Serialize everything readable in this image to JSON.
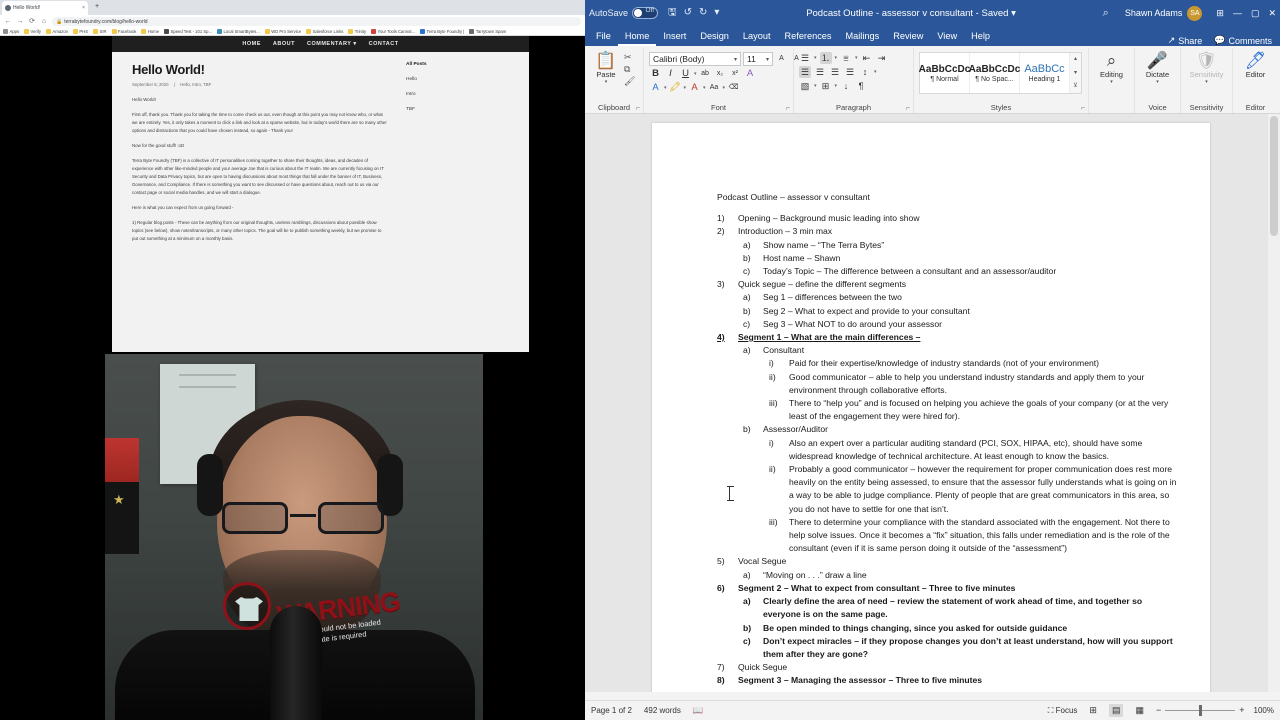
{
  "browser": {
    "tab": {
      "title": "Hello World!",
      "close_label": "×"
    },
    "new_tab_label": "+",
    "nav": {
      "back": "←",
      "forward": "→",
      "reload": "⟳",
      "home": "⌂"
    },
    "omnibox": {
      "lock": "🔒",
      "url": "terrabytefoundry.com/blog/hello-world"
    },
    "bookmarks": [
      {
        "label": "Apps",
        "color": "#8e8e8e"
      },
      {
        "label": "Verify",
        "color": "#f2c94c"
      },
      {
        "label": "Amazon",
        "color": "#f2c94c"
      },
      {
        "label": "PHS",
        "color": "#f2c94c"
      },
      {
        "label": "SIR",
        "color": "#f2c94c"
      },
      {
        "label": "Facebook",
        "color": "#f2c94c"
      },
      {
        "label": "Home",
        "color": "#f2c94c"
      },
      {
        "label": "Speed Test - 101 Sp...",
        "color": "#4a4a4a"
      },
      {
        "label": "Local SmartBytes...",
        "color": "#3c8dbc"
      },
      {
        "label": "WD Pro Service",
        "color": "#f2c94c"
      },
      {
        "label": "Salesforce Links",
        "color": "#f2c94c"
      },
      {
        "label": "Trinity",
        "color": "#f2c94c"
      },
      {
        "label": "Your Tools Cannot...",
        "color": "#d0433a"
      },
      {
        "label": "Terra Byte Foundry |",
        "color": "#2a6fd6"
      },
      {
        "label": "Tarrytown Spam",
        "color": "#6c6c6c"
      }
    ]
  },
  "site": {
    "nav": [
      "HOME",
      "ABOUT",
      "COMMENTARY ▾",
      "CONTACT"
    ],
    "post": {
      "title": "Hello World!",
      "date": "September 8, 2020",
      "tags": "Hello, Intro, TBF",
      "paragraphs": [
        "Hello World!",
        "First off, thank you.  Thank you for taking the time to come check us out, even though at this point you may not know who, or what we are entirely.  Yes, it only takes a moment to click a link and look at a sparse website, but in today's world there are so many other options and distractions that you could have chosen instead, so again - Thank you!",
        "Now for the good stuff! :oD",
        "Terra Byte Foundry (TBF) is a collective of IT personalities coming together to share their thoughts, ideas, and decades of experience with other like-minded people and your average Joe that is curious about the IT realm.  We are currently focusing on IT Security and Data Privacy topics, but are open to having discussions about most things that fall under the banner of IT, Business, Governance, and Compliance.  If there is something you want to see discussed or have questions about, reach out to us via our contact page or social media handles, and we will start a dialogue.",
        "Here is what you can expect from us going forward -",
        "1) Regular blog posts - These can be anything from our original thoughts, useless ramblings, discussions about possible show topics (see below), show notes/transcripts, or many other topics.  The goal will be to publish something weekly, but we promise to put out something at a minimum on a monthly basis."
      ]
    },
    "sidebar": {
      "heading": "All Posts",
      "links": [
        "Hello",
        "Intro",
        "TBF"
      ]
    }
  },
  "webcam": {
    "warning_text": "WARNING",
    "warning_sub1": "graphic could not be loaded",
    "warning_sub2": "software update is required"
  },
  "word": {
    "titlebar": {
      "autosave_label": "AutoSave",
      "autosave_state": "Off",
      "quick_access": [
        {
          "name": "save-icon",
          "glyph": "🖫"
        },
        {
          "name": "undo-icon",
          "glyph": "↺"
        },
        {
          "name": "redo-icon",
          "glyph": "↻"
        },
        {
          "name": "customize-qat-icon",
          "glyph": "▾"
        }
      ],
      "document_title": "Podcast Outline - assessor v consultant  -  Saved ▾",
      "search_icon": "⌕",
      "user_name": "Shawn Adams",
      "user_initials": "SA",
      "ribbon_display_icon": "⊞",
      "minimize": "—",
      "maximize": "▢",
      "close": "✕"
    },
    "tabs": [
      {
        "label": "File",
        "active": false
      },
      {
        "label": "Home",
        "active": true
      },
      {
        "label": "Insert",
        "active": false
      },
      {
        "label": "Design",
        "active": false
      },
      {
        "label": "Layout",
        "active": false
      },
      {
        "label": "References",
        "active": false
      },
      {
        "label": "Mailings",
        "active": false
      },
      {
        "label": "Review",
        "active": false
      },
      {
        "label": "View",
        "active": false
      },
      {
        "label": "Help",
        "active": false
      }
    ],
    "tabs_right": [
      {
        "label": "Share",
        "icon": "↗"
      },
      {
        "label": "Comments",
        "icon": "💬"
      }
    ],
    "ribbon": {
      "clipboard": {
        "group_label": "Clipboard",
        "paste_label": "Paste",
        "paste_icon": "📋",
        "paste_caret": "▾",
        "cut_icon": "✂",
        "copy_icon": "⧉",
        "format_painter_icon": "🖌",
        "dialog_launcher": "⌐"
      },
      "font": {
        "group_label": "Font",
        "font_name": "Calibri (Body)",
        "font_size": "11",
        "bold": "B",
        "italic": "I",
        "underline": "U",
        "strikethrough": "ab",
        "subscript": "x₂",
        "superscript": "x²",
        "text_effects_icon": "A",
        "text_highlight_icon": "🖍",
        "font_color_icon": "A",
        "change_case_icon": "Aa",
        "grow_font": "A",
        "shrink_font": "A",
        "clear_formatting": "⌫",
        "dialog_launcher": "⌐"
      },
      "paragraph": {
        "group_label": "Paragraph",
        "bullets_icon": "☰",
        "numbering_icon": "⒈",
        "multilevel_icon": "⩸",
        "decrease_indent": "⇤",
        "increase_indent": "⇥",
        "align_left": "☰",
        "align_center": "☰",
        "align_right": "☰",
        "justify": "☰",
        "line_spacing": "↕",
        "shading_icon": "▧",
        "borders_icon": "⊞",
        "sort_icon": "↓",
        "show_marks_icon": "¶",
        "dialog_launcher": "⌐"
      },
      "styles": {
        "group_label": "Styles",
        "items": [
          {
            "preview": "AaBbCcDc",
            "name": "¶ Normal"
          },
          {
            "preview": "AaBbCcDc",
            "name": "¶ No Spac..."
          },
          {
            "preview": "AaBbCc",
            "name": "Heading 1"
          }
        ],
        "scroll_up": "▴",
        "scroll_down": "▾",
        "more": "⊻",
        "dialog_launcher": "⌐"
      },
      "editing": {
        "group_label": "",
        "label": "Editing",
        "icon": "⌕",
        "caret": "▾"
      },
      "voice": {
        "group_label": "Voice",
        "label": "Dictate",
        "icon": "🎤",
        "caret": "▾"
      },
      "sensitivity": {
        "group_label": "Sensitivity",
        "label": "Sensitivity",
        "icon": "🛡",
        "caret": "▾"
      },
      "editor": {
        "group_label": "Editor",
        "label": "Editor",
        "icon": "🖊"
      }
    },
    "document": {
      "title": "Podcast Outline – assessor v consultant",
      "items": [
        {
          "level": 1,
          "marker": "1)",
          "text": "Opening – Background music leading into show",
          "bold": false,
          "underline": false
        },
        {
          "level": 1,
          "marker": "2)",
          "text": "Introduction – 3 min max",
          "bold": false,
          "underline": false
        },
        {
          "level": 2,
          "marker": "a)",
          "text": "Show name – “The Terra Bytes”",
          "bold": false,
          "underline": false
        },
        {
          "level": 2,
          "marker": "b)",
          "text": "Host name – Shawn",
          "bold": false,
          "underline": false
        },
        {
          "level": 2,
          "marker": "c)",
          "text": "Today’s Topic – The difference between a consultant and an assessor/auditor",
          "bold": false,
          "underline": false
        },
        {
          "level": 1,
          "marker": "3)",
          "text": "Quick segue – define the different segments",
          "bold": false,
          "underline": false
        },
        {
          "level": 2,
          "marker": "a)",
          "text": "Seg 1 – differences between the two",
          "bold": false,
          "underline": false
        },
        {
          "level": 2,
          "marker": "b)",
          "text": "Seg 2 – What to expect and provide to your consultant",
          "bold": false,
          "underline": false
        },
        {
          "level": 2,
          "marker": "c)",
          "text": "Seg 3 – What NOT to do around your assessor",
          "bold": false,
          "underline": false
        },
        {
          "level": 1,
          "marker": "4)",
          "text": "Segment 1 – What are the main differences –",
          "bold": true,
          "underline": true
        },
        {
          "level": 2,
          "marker": "a)",
          "text": "Consultant",
          "bold": false,
          "underline": false
        },
        {
          "level": 3,
          "marker": "i)",
          "text": "Paid for their expertise/knowledge of industry standards (not of your environment)",
          "bold": false,
          "underline": false
        },
        {
          "level": 3,
          "marker": "ii)",
          "text": "Good communicator – able to help you understand industry standards and apply them to your environment through collaborative efforts.",
          "bold": false,
          "underline": false
        },
        {
          "level": 3,
          "marker": "iii)",
          "text": "There to “help you” and is focused on helping you achieve the goals of your company (or at the very least of the engagement they were hired for).",
          "bold": false,
          "underline": false
        },
        {
          "level": 2,
          "marker": "b)",
          "text": "Assessor/Auditor",
          "bold": false,
          "underline": false
        },
        {
          "level": 3,
          "marker": "i)",
          "text": "Also an expert over a particular auditing standard (PCI, SOX, HIPAA, etc), should have some widespread knowledge of technical architecture.  At least enough to know the basics.",
          "bold": false,
          "underline": false
        },
        {
          "level": 3,
          "marker": "ii)",
          "text": "Probably a good communicator – however the requirement for proper communication does rest more heavily on the entity being assessed, to ensure that the assessor fully understands what is going on in a way to be able to judge compliance.  Plenty of people that are great communicators in this area, so you do not have to settle for one that isn’t.",
          "bold": false,
          "underline": false
        },
        {
          "level": 3,
          "marker": "iii)",
          "text": "There to determine your compliance with the standard associated with the engagement.  Not there to help solve issues.  Once it becomes a “fix” situation, this falls under remediation and is the role of the consultant (even if it is same person doing it outside of the “assessment”)",
          "bold": false,
          "underline": false
        },
        {
          "level": 1,
          "marker": "5)",
          "text": "Vocal Segue",
          "bold": false,
          "underline": false
        },
        {
          "level": 2,
          "marker": "a)",
          "text": "“Moving on . . .” draw a line",
          "bold": false,
          "underline": false
        },
        {
          "level": 1,
          "marker": "6)",
          "text": "Segment 2 – What to expect from consultant – Three to five minutes",
          "bold": true,
          "underline": false
        },
        {
          "level": 2,
          "marker": "a)",
          "text": "Clearly define the area of need – review the statement of work ahead of time, and together so everyone is on the same page.",
          "bold": true,
          "underline": false
        },
        {
          "level": 2,
          "marker": "b)",
          "text": "Be open minded to things changing, since you asked for outside guidance",
          "bold": true,
          "underline": false
        },
        {
          "level": 2,
          "marker": "c)",
          "text": "Don’t expect miracles – if they propose changes you don’t at least understand, how will you support them after they are gone?",
          "bold": true,
          "underline": false
        },
        {
          "level": 1,
          "marker": "7)",
          "text": "Quick Segue",
          "bold": false,
          "underline": false
        },
        {
          "level": 1,
          "marker": "8)",
          "text": "Segment 3 – Managing the assessor – Three to five minutes",
          "bold": true,
          "underline": false
        }
      ]
    },
    "status": {
      "page": "Page 1 of 2",
      "words": "492 words",
      "proofing_icon": "📖",
      "focus_label": "Focus",
      "focus_icon": "⛶",
      "view_read": "⊞",
      "view_print": "▤",
      "view_web": "▦",
      "zoom_out": "−",
      "zoom_in": "+",
      "zoom_level": "100%"
    }
  }
}
